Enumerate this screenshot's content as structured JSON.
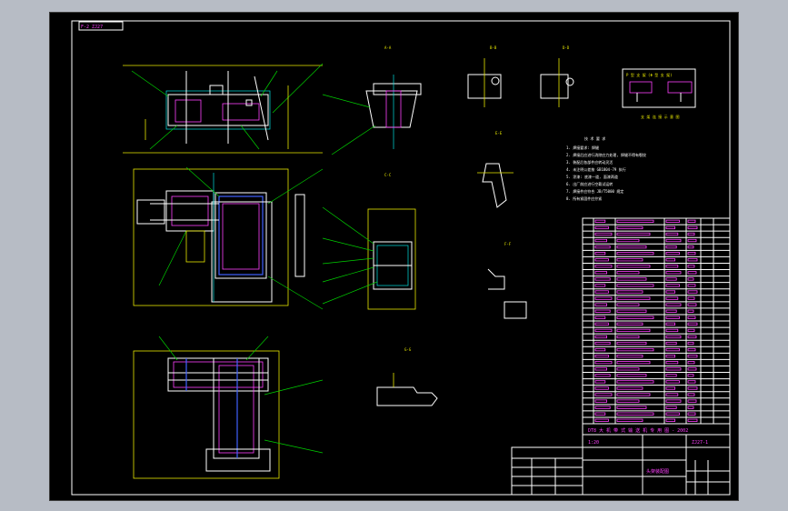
{
  "drawing": {
    "title_block": {
      "drawing_no": "ZJ27-1",
      "university": "DT8 大 机  带 式 输 送 机 专 用 图 - 2002",
      "part_name": "头架装配图",
      "sheet_scale": "1:20"
    },
    "stamp": "F-2 ZJ27",
    "section_labels": [
      "A-A",
      "B-B",
      "C-C",
      "D-D",
      "E-E",
      "F-F",
      "G-G",
      "H-H"
    ],
    "tech_req_title": "技 术 要 求",
    "tech_req_lines": [
      "1. 焊接要求: 焊缝",
      "2. 焊接后应进行消除应力处理, 焊缝不得有裂纹",
      "3. 装配后各部件应转动灵活",
      "4. 未注明公差按 GB1804-79 执行",
      "5. 涂漆: 底漆一道, 面漆两道",
      "6. 出厂前应进行空载试运转",
      "7. 焊接件应符合 JB/T5000 规定",
      "8. 所有紧固件应拧紧"
    ],
    "inset_title": "P 型 支 架 (Φ 型 支 架)",
    "inset_caption": "支 架 连 接 示 意 图",
    "bom_rows": 32
  }
}
